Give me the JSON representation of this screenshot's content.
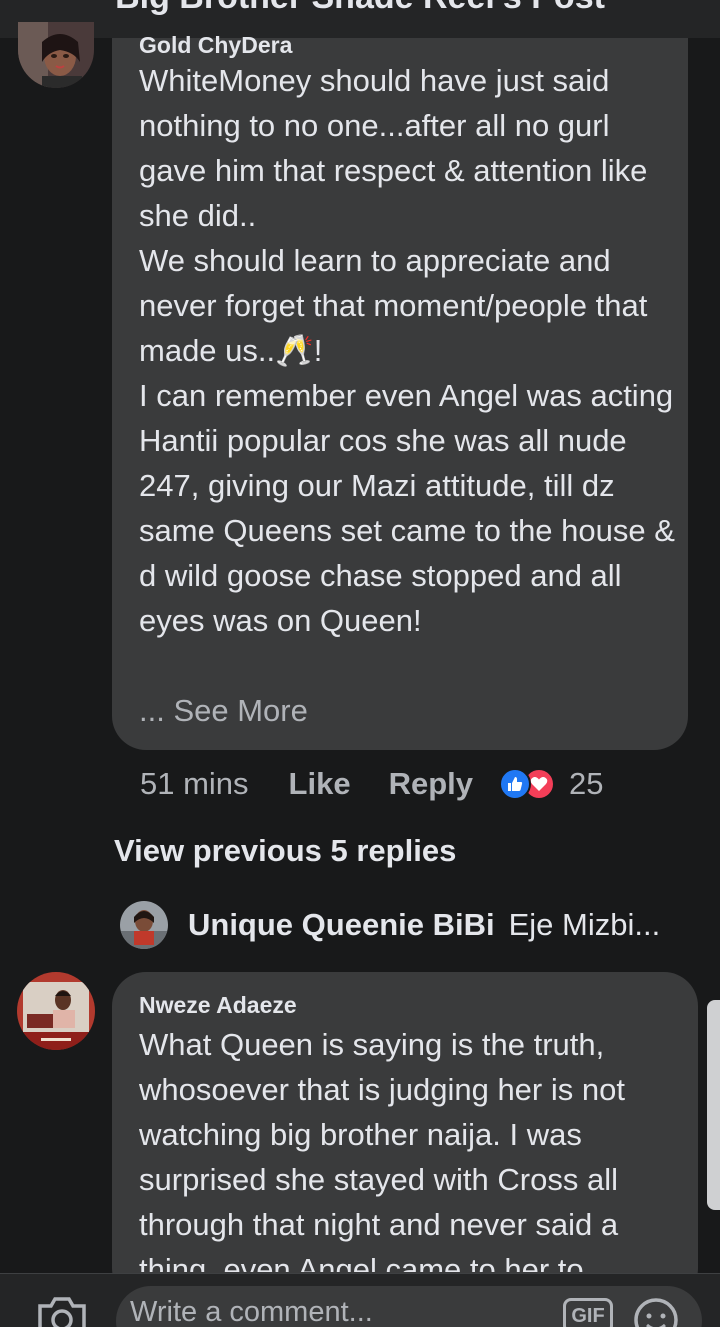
{
  "header": {
    "title": "Big Brother Shade Reel's Post"
  },
  "comment1": {
    "author": "Gold ChyDera",
    "text": "WhiteMoney should have just said nothing to no one...after all no gurl gave him that respect & attention like she did..\nWe should learn to appreciate and never forget that moment/people that made us..🥂!\nI can remember even Angel was acting Hantii popular cos she was all nude 247, giving our Mazi attitude, till dz same Queens set came to the house & d wild goose chase stopped and all eyes was on Queen!",
    "see_more": "... See More",
    "time": "51 mins",
    "like_label": "Like",
    "reply_label": "Reply",
    "reaction_count": "25"
  },
  "view_previous": "View previous 5 replies",
  "reply_preview": {
    "name": "Unique Queenie BiBi",
    "text": "Eje Mizbi..."
  },
  "comment2": {
    "author": "Nweze Adaeze",
    "text": "What Queen is saying is the truth, whosoever that is judging her is not watching big brother naija. I was surprised she stayed with Cross all through that night and never said a thing, even Angel came to her to"
  },
  "composer": {
    "placeholder": "Write a comment...",
    "gif_label": "GIF"
  },
  "colors": {
    "background": "#18191a",
    "bubble": "#3a3b3c",
    "like_blue": "#2078f4",
    "love_red": "#f33e58"
  }
}
